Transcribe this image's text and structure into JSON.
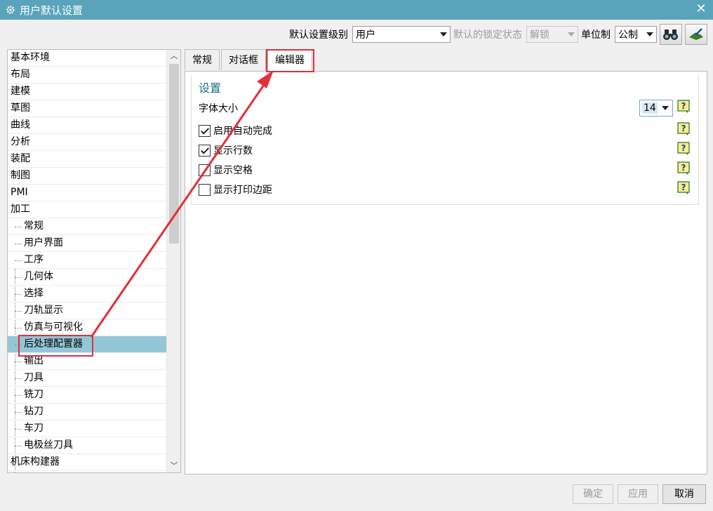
{
  "window": {
    "title": "用户默认设置",
    "close_label": "✕"
  },
  "topbar": {
    "level_label": "默认设置级别",
    "level_value": "用户",
    "lock_label": "默认的锁定状态",
    "lock_value": "解锁",
    "unit_label": "单位制",
    "unit_value": "公制"
  },
  "sidebar": {
    "items": [
      {
        "label": "基本环境",
        "child": false
      },
      {
        "label": "布局",
        "child": false
      },
      {
        "label": "建模",
        "child": false
      },
      {
        "label": "草图",
        "child": false
      },
      {
        "label": "曲线",
        "child": false
      },
      {
        "label": "分析",
        "child": false
      },
      {
        "label": "装配",
        "child": false
      },
      {
        "label": "制图",
        "child": false
      },
      {
        "label": "PMI",
        "child": false
      },
      {
        "label": "加工",
        "child": false
      },
      {
        "label": "常规",
        "child": true
      },
      {
        "label": "用户界面",
        "child": true
      },
      {
        "label": "工序",
        "child": true
      },
      {
        "label": "几何体",
        "child": true
      },
      {
        "label": "选择",
        "child": true
      },
      {
        "label": "刀轨显示",
        "child": true
      },
      {
        "label": "仿真与可视化",
        "child": true
      },
      {
        "label": "后处理配置器",
        "child": true,
        "selected": true
      },
      {
        "label": "输出",
        "child": true
      },
      {
        "label": "刀具",
        "child": true
      },
      {
        "label": "铣刀",
        "child": true
      },
      {
        "label": "钻刀",
        "child": true
      },
      {
        "label": "车刀",
        "child": true
      },
      {
        "label": "电极丝刀具",
        "child": true
      },
      {
        "label": "机床构建器",
        "child": false
      }
    ]
  },
  "tabs": [
    {
      "label": "常规"
    },
    {
      "label": "对话框"
    },
    {
      "label": "编辑器",
      "active": true
    }
  ],
  "settings": {
    "group_title": "设置",
    "font_size_label": "字体大小",
    "font_size_value": "14",
    "options": [
      {
        "label": "启用自动完成",
        "checked": true
      },
      {
        "label": "显示行数",
        "checked": true
      },
      {
        "label": "显示空格",
        "checked": false
      },
      {
        "label": "显示打印边距",
        "checked": false
      }
    ]
  },
  "buttons": {
    "ok": "确定",
    "apply": "应用",
    "cancel": "取消"
  },
  "colors": {
    "titlebar": "#5aa4bb",
    "selected_row": "#93c7d7",
    "annotation": "#e0303a",
    "group_title": "#1f6f8b"
  },
  "icons": [
    "gear-icon",
    "close-icon",
    "binoculars-icon",
    "import-icon",
    "help-icon"
  ]
}
